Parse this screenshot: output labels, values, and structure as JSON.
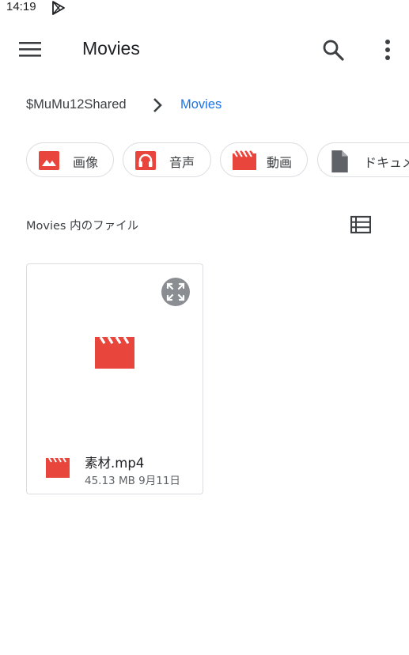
{
  "status_bar": {
    "time": "14:19",
    "app_icon": "play-store-icon"
  },
  "app_bar": {
    "title": "Movies",
    "menu_icon": "hamburger-menu-icon",
    "search_icon": "search-icon",
    "more_icon": "more-vert-icon"
  },
  "breadcrumb": {
    "root": "$MuMu12Shared",
    "separator_icon": "chevron-right-icon",
    "current": "Movies"
  },
  "filter_chips": [
    {
      "label": "画像",
      "icon": "image-icon"
    },
    {
      "label": "音声",
      "icon": "headphones-icon"
    },
    {
      "label": "動画",
      "icon": "movie-icon"
    },
    {
      "label": "ドキュメ",
      "icon": "document-icon"
    }
  ],
  "section": {
    "title": "Movies 内のファイル",
    "view_toggle_icon": "list-view-icon"
  },
  "files": [
    {
      "name": "素材.mp4",
      "meta": "45.13 MB 9月11日",
      "type_icon": "movie-icon",
      "expand_icon": "fullscreen-icon"
    }
  ],
  "colors": {
    "accent": "#1a73e8",
    "icon_red": "#e8453c",
    "icon_grey": "#5f6368",
    "chip_border": "#dadce0"
  }
}
